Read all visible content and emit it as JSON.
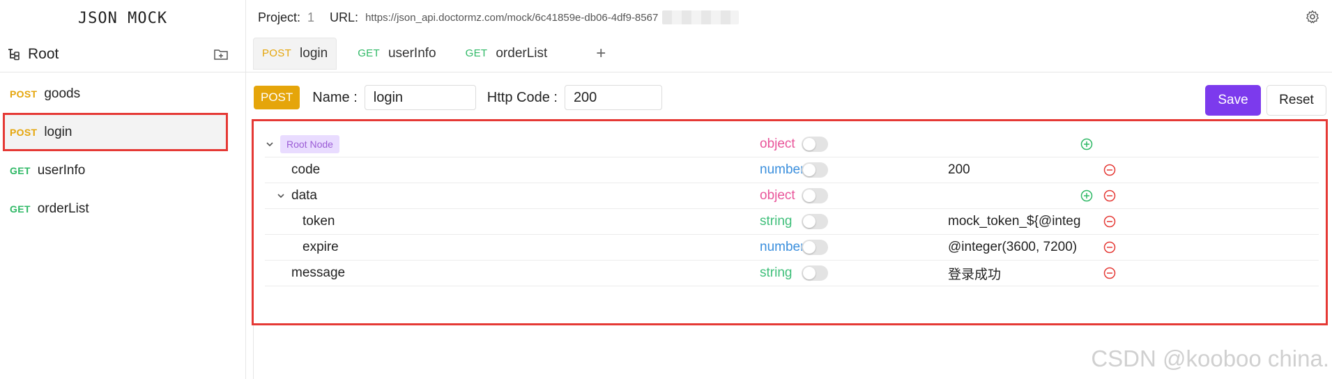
{
  "sidebar": {
    "app_title": "JSON MOCK",
    "root_label": "Root",
    "items": [
      {
        "method": "POST",
        "name": "goods"
      },
      {
        "method": "POST",
        "name": "login"
      },
      {
        "method": "GET",
        "name": "userInfo"
      },
      {
        "method": "GET",
        "name": "orderList"
      }
    ]
  },
  "topbar": {
    "project_label": "Project:",
    "project_value": "1",
    "url_label": "URL:",
    "url_value": "https://json_api.doctormz.com/mock/6c41859e-db06-4df9-8567"
  },
  "tabs": [
    {
      "method": "POST",
      "label": "login"
    },
    {
      "method": "GET",
      "label": "userInfo"
    },
    {
      "method": "GET",
      "label": "orderList"
    }
  ],
  "tab_add_label": "+",
  "form": {
    "method": "POST",
    "name_label": "Name :",
    "name_value": "login",
    "code_label": "Http Code :",
    "code_value": "200",
    "save_label": "Save",
    "reset_label": "Reset"
  },
  "tree": {
    "root_badge": "Root Node",
    "root_type": "object",
    "rows": [
      {
        "key": "code",
        "type": "number",
        "value": "200"
      },
      {
        "key": "data",
        "type": "object",
        "value": ""
      },
      {
        "key": "token",
        "type": "string",
        "value": "mock_token_${@intege"
      },
      {
        "key": "expire",
        "type": "number",
        "value": "@integer(3600, 7200)"
      },
      {
        "key": "message",
        "type": "string",
        "value": "登录成功"
      }
    ]
  },
  "watermark": "CSDN @kooboo china.",
  "colors": {
    "post": "#e5a50a",
    "get": "#2eb865",
    "save": "#7c3aed",
    "highlight": "#e53935",
    "type_object": "#e9559a",
    "type_number": "#3b8fdd",
    "type_string": "#3fbf7a"
  }
}
